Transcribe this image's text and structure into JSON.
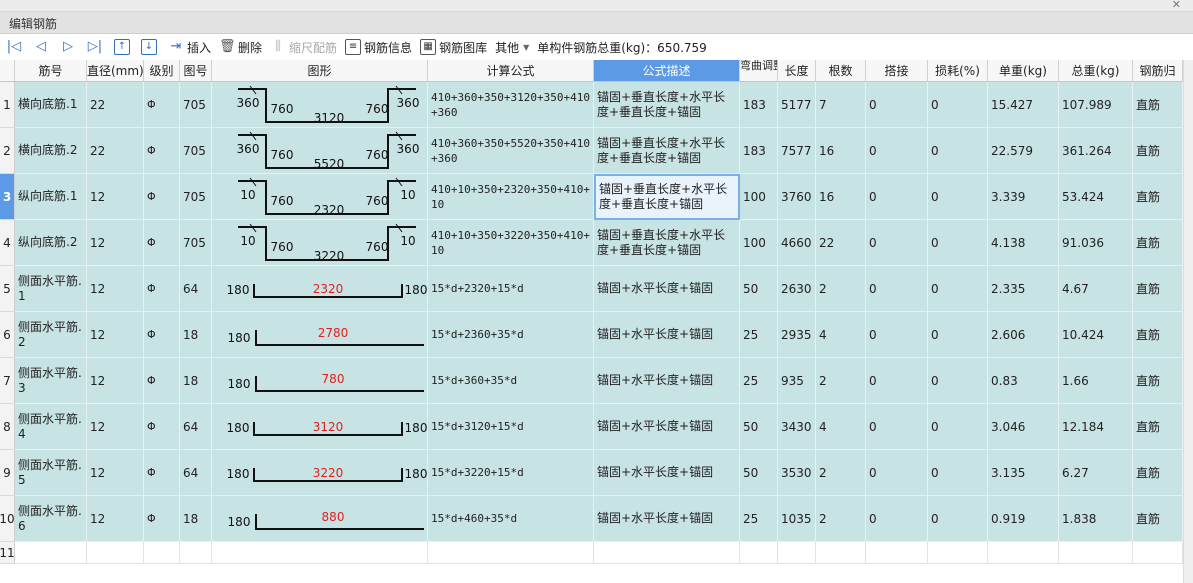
{
  "window": {
    "close_icon": "close-icon"
  },
  "panel": {
    "title": "编辑钢筋"
  },
  "toolbar": {
    "insert": "插入",
    "delete": "删除",
    "scale_rebar": "缩尺配筋",
    "rebar_info": "钢筋信息",
    "rebar_library": "钢筋图库",
    "other": "其他",
    "total_weight": "单构件钢筋总重(kg)：650.759"
  },
  "columns": [
    "筋号",
    "直径(mm)",
    "级别",
    "图号",
    "图形",
    "计算公式",
    "公式描述",
    "弯曲调整",
    "长度",
    "根数",
    "搭接",
    "损耗(%)",
    "单重(kg)",
    "总重(kg)",
    "钢筋归"
  ],
  "rows": [
    {
      "num": "1",
      "name": "横向底筋.1",
      "dia": "22",
      "grade": "Φ",
      "fig": "705",
      "shape": "u",
      "s_left": "360",
      "s_l2": "760",
      "s_mid": "3120",
      "s_r2": "760",
      "s_right": "360",
      "formula": "410+360+350+3120+350+410+360",
      "desc": "锚固+垂直长度+水平长度+垂直长度+锚固",
      "bend": "183",
      "length": "5177",
      "count": "7",
      "lap": "0",
      "loss": "0",
      "unit_w": "15.427",
      "total_w": "107.989",
      "type": "直筋"
    },
    {
      "num": "2",
      "name": "横向底筋.2",
      "dia": "22",
      "grade": "Φ",
      "fig": "705",
      "shape": "u",
      "s_left": "360",
      "s_l2": "760",
      "s_mid": "5520",
      "s_r2": "760",
      "s_right": "360",
      "formula": "410+360+350+5520+350+410+360",
      "desc": "锚固+垂直长度+水平长度+垂直长度+锚固",
      "bend": "183",
      "length": "7577",
      "count": "16",
      "lap": "0",
      "loss": "0",
      "unit_w": "22.579",
      "total_w": "361.264",
      "type": "直筋"
    },
    {
      "num": "3",
      "name": "纵向底筋.1",
      "dia": "12",
      "grade": "Φ",
      "fig": "705",
      "shape": "u",
      "s_left": "10",
      "s_l2": "760",
      "s_mid": "2320",
      "s_r2": "760",
      "s_right": "10",
      "formula": "410+10+350+2320+350+410+10",
      "desc": "锚固+垂直长度+水平长度+垂直长度+锚固",
      "bend": "100",
      "length": "3760",
      "count": "16",
      "lap": "0",
      "loss": "0",
      "unit_w": "3.339",
      "total_w": "53.424",
      "type": "直筋"
    },
    {
      "num": "4",
      "name": "纵向底筋.2",
      "dia": "12",
      "grade": "Φ",
      "fig": "705",
      "shape": "u",
      "s_left": "10",
      "s_l2": "760",
      "s_mid": "3220",
      "s_r2": "760",
      "s_right": "10",
      "formula": "410+10+350+3220+350+410+10",
      "desc": "锚固+垂直长度+水平长度+垂直长度+锚固",
      "bend": "100",
      "length": "4660",
      "count": "22",
      "lap": "0",
      "loss": "0",
      "unit_w": "4.138",
      "total_w": "91.036",
      "type": "直筋"
    },
    {
      "num": "5",
      "name": "侧面水平筋.1",
      "dia": "12",
      "grade": "Φ",
      "fig": "64",
      "shape": "c",
      "s_left": "180",
      "s_mid": "2320",
      "s_right": "180",
      "formula": "15*d+2320+15*d",
      "desc": "锚固+水平长度+锚固",
      "bend": "50",
      "length": "2630",
      "count": "2",
      "lap": "0",
      "loss": "0",
      "unit_w": "2.335",
      "total_w": "4.67",
      "type": "直筋"
    },
    {
      "num": "6",
      "name": "侧面水平筋.2",
      "dia": "12",
      "grade": "Φ",
      "fig": "18",
      "shape": "l",
      "s_left": "180",
      "s_mid": "2780",
      "formula": "15*d+2360+35*d",
      "desc": "锚固+水平长度+锚固",
      "bend": "25",
      "length": "2935",
      "count": "4",
      "lap": "0",
      "loss": "0",
      "unit_w": "2.606",
      "total_w": "10.424",
      "type": "直筋"
    },
    {
      "num": "7",
      "name": "侧面水平筋.3",
      "dia": "12",
      "grade": "Φ",
      "fig": "18",
      "shape": "l",
      "s_left": "180",
      "s_mid": "780",
      "formula": "15*d+360+35*d",
      "desc": "锚固+水平长度+锚固",
      "bend": "25",
      "length": "935",
      "count": "2",
      "lap": "0",
      "loss": "0",
      "unit_w": "0.83",
      "total_w": "1.66",
      "type": "直筋"
    },
    {
      "num": "8",
      "name": "侧面水平筋.4",
      "dia": "12",
      "grade": "Φ",
      "fig": "64",
      "shape": "c",
      "s_left": "180",
      "s_mid": "3120",
      "s_right": "180",
      "formula": "15*d+3120+15*d",
      "desc": "锚固+水平长度+锚固",
      "bend": "50",
      "length": "3430",
      "count": "4",
      "lap": "0",
      "loss": "0",
      "unit_w": "3.046",
      "total_w": "12.184",
      "type": "直筋"
    },
    {
      "num": "9",
      "name": "侧面水平筋.5",
      "dia": "12",
      "grade": "Φ",
      "fig": "64",
      "shape": "c",
      "s_left": "180",
      "s_mid": "3220",
      "s_right": "180",
      "formula": "15*d+3220+15*d",
      "desc": "锚固+水平长度+锚固",
      "bend": "50",
      "length": "3530",
      "count": "2",
      "lap": "0",
      "loss": "0",
      "unit_w": "3.135",
      "total_w": "6.27",
      "type": "直筋"
    },
    {
      "num": "10",
      "name": "侧面水平筋.6",
      "dia": "12",
      "grade": "Φ",
      "fig": "18",
      "shape": "l",
      "s_left": "180",
      "s_mid": "880",
      "formula": "15*d+460+35*d",
      "desc": "锚固+水平长度+锚固",
      "bend": "25",
      "length": "1035",
      "count": "2",
      "lap": "0",
      "loss": "0",
      "unit_w": "0.919",
      "total_w": "1.838",
      "type": "直筋"
    }
  ],
  "empty_row_num": "11",
  "selected_row": "3",
  "active_column": "公式描述",
  "colors": {
    "row_bg": "#c8e3e3",
    "header_active": "#5d9ae6",
    "dim_red": "#e02020"
  }
}
